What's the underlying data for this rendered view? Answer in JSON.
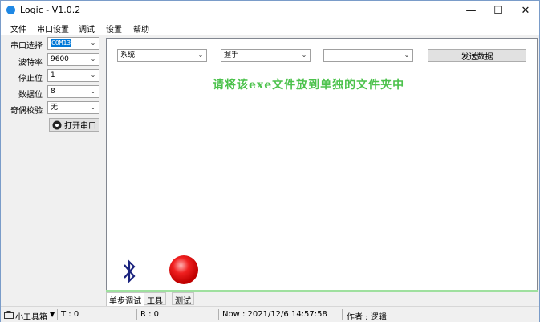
{
  "window": {
    "title": "Logic - V1.0.2"
  },
  "window_buttons": {
    "minimize": "—",
    "maximize": "☐",
    "close": "✕"
  },
  "menu": [
    "文件",
    "串口设置",
    "调试",
    "设置",
    "帮助"
  ],
  "serial": {
    "port_label": "串口选择",
    "port_value": "COM13",
    "baud_label": "波特率",
    "baud_value": "9600",
    "stop_label": "停止位",
    "stop_value": "1",
    "data_label": "数据位",
    "data_value": "8",
    "parity_label": "奇偶校验",
    "parity_value": "无",
    "open_button": "打开串口"
  },
  "main": {
    "combo1": "系统",
    "combo2": "握手",
    "combo3": "",
    "send_button": "发送数据",
    "hint": "请将该exe文件放到单独的文件夹中",
    "status_light_color": "#e81010"
  },
  "tabs": [
    "单步调试",
    "工具",
    "测试"
  ],
  "status": {
    "toolbox": "小工具箱",
    "tx": "T : 0",
    "rx": "R : 0",
    "now": "Now : 2021/12/6 14:57:58",
    "author": "作者 : 逻辑"
  }
}
